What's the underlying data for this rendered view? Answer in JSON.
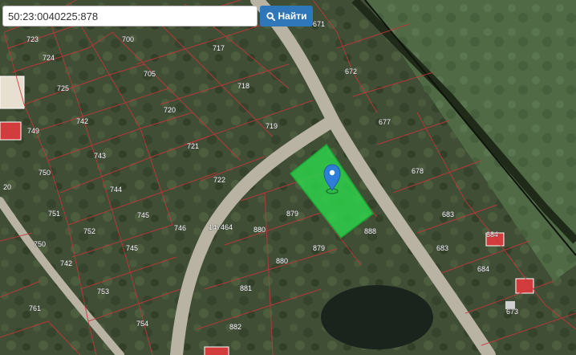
{
  "search": {
    "value": "50:23:0040225:878",
    "button_label": "Найти"
  },
  "map": {
    "plot_labels": [
      "723",
      "724",
      "700",
      "717",
      "671",
      "672",
      "705",
      "725",
      "718",
      "742",
      "720",
      "677",
      "749",
      "719",
      "743",
      "721",
      "678",
      "750",
      "722",
      "744",
      "879",
      "683",
      "751",
      "745",
      "147464",
      "880",
      "684",
      "752",
      "746",
      "745",
      "888",
      "683",
      "879",
      "880",
      "684",
      "753",
      "761",
      "881",
      "673",
      "754",
      "882",
      "742",
      "750",
      "20"
    ],
    "marker": {
      "icon": "location-pin-icon",
      "color": "#2f7fd8"
    },
    "selected_plot_color": "#2ed14a"
  }
}
